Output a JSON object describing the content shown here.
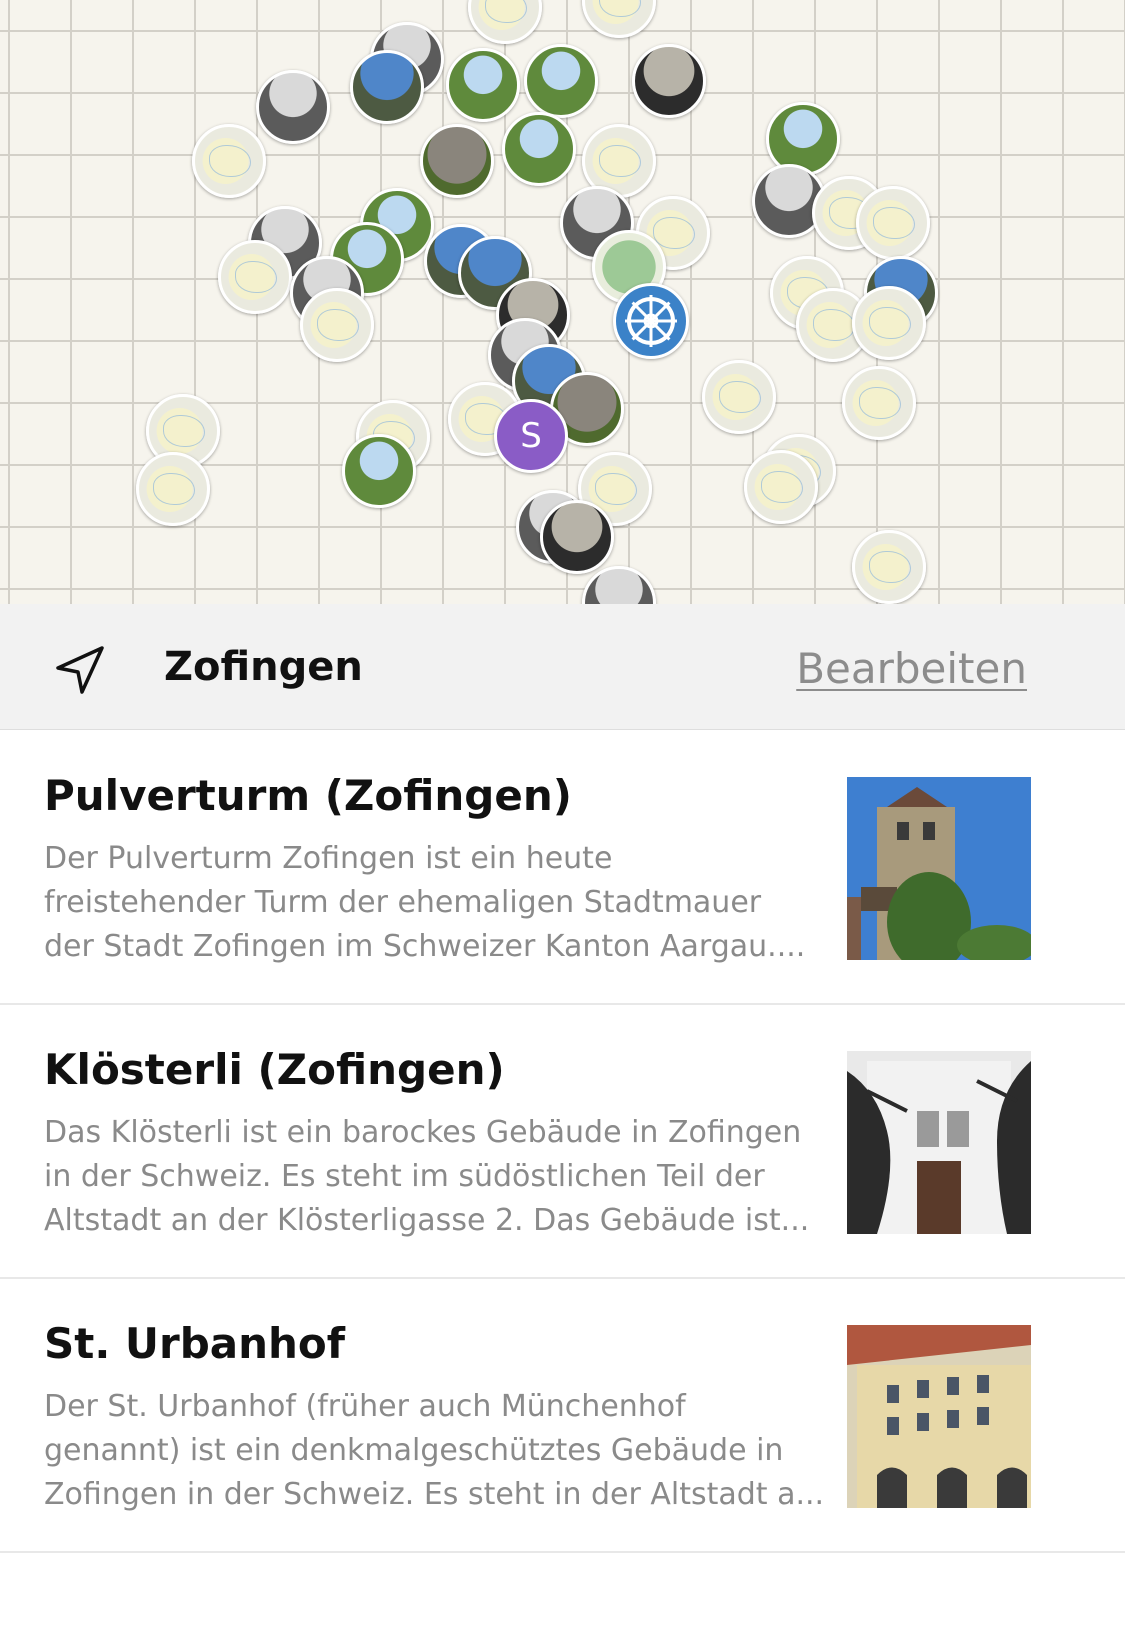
{
  "map": {
    "cluster_letter": "S"
  },
  "header": {
    "location": "Zofingen",
    "edit_label": "Bearbeiten",
    "location_icon": "navigation-arrow-icon"
  },
  "articles": [
    {
      "title": "Pulverturm (Zofingen)",
      "lines": [
        "Der Pulverturm Zofingen ist ein heute",
        "freistehender Turm der ehemaligen Stadtmauer",
        "der Stadt Zofingen im Schweizer Kanton Aargau...."
      ]
    },
    {
      "title": "Klösterli (Zofingen)",
      "lines": [
        "Das Klösterli ist ein barockes Gebäude in Zofingen",
        "in der Schweiz. Es steht im südöstlichen Teil der",
        "Altstadt an der Klösterligasse 2. Das Gebäude ist..."
      ]
    },
    {
      "title": "St. Urbanhof",
      "lines": [
        "Der St. Urbanhof (früher auch Münchenhof",
        "genannt) ist ein denkmalgeschütztes Gebäude in",
        "Zofingen in der Schweiz. Es steht in der Altstadt a..."
      ]
    }
  ]
}
